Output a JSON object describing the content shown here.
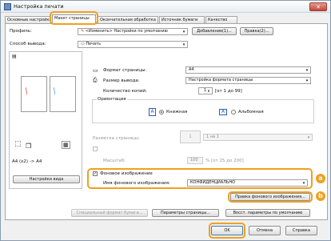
{
  "window": {
    "title": "Настройка печати",
    "close": "✕"
  },
  "tabs": [
    "Основные настройки",
    "Макет страницы",
    "Окончательная обработка",
    "Источник бумаги",
    "Качество"
  ],
  "profile": {
    "label": "Профиль:",
    "value": "<Изменить> Настройки по умолчанию",
    "add": "Добавление(1)...",
    "edit": "Правка(2)..."
  },
  "output": {
    "label": "Способ вывода:",
    "value": "Печать"
  },
  "preview": {
    "caption": "A4 (x2) -> A4",
    "view_settings": "Настройки вида"
  },
  "page_size": {
    "label": "Формат страницы:",
    "value": "A4"
  },
  "output_size": {
    "label": "Размер вывода:",
    "value": "Настройка формата страницы"
  },
  "copies": {
    "label": "Количество копий:",
    "value": "1",
    "range": "[от 1 до 99]"
  },
  "orientation": {
    "label": "Ориентация",
    "portrait": "Книжная",
    "landscape": "Альбомная",
    "icon_letter": "A"
  },
  "layout": {
    "label": "Разметка страницы:",
    "value": "1 на 1",
    "icon": "1"
  },
  "scaling": {
    "label": "Ручная настройка масштаба",
    "scale_label": "Масштаб:",
    "scale_value": "100",
    "scale_range": "% [от 25 до 200]"
  },
  "watermark": {
    "checkbox_label": "Фоновое изображение",
    "name_label": "Имя фонового изображения:",
    "name_value": "КОНФИДЕНЦИАЛЬНО",
    "edit": "Правка фонового изображения...",
    "badge_a": "a",
    "badge_b": "b"
  },
  "bottom": {
    "custom": "Специальный формат бумаги...",
    "page_params": "Параметры страницы...",
    "restore": "Восст. параметры по умолчанию"
  },
  "dialog": {
    "ok": "OK",
    "cancel": "Отмена",
    "help": "Справка"
  }
}
